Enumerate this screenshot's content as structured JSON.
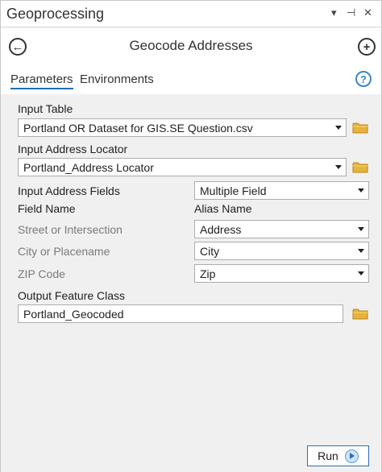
{
  "pane": {
    "title": "Geoprocessing",
    "menu_icon": "dropdown-arrow-icon",
    "pin_icon": "pin-icon",
    "close_icon": "close-icon"
  },
  "tool": {
    "title": "Geocode Addresses",
    "back_icon": "back-arrow-icon",
    "add_icon": "add-icon"
  },
  "tabs": {
    "parameters": "Parameters",
    "environments": "Environments",
    "help_icon": "help-icon",
    "help_glyph": "?"
  },
  "params": {
    "input_table_label": "Input Table",
    "input_table_value": "Portland OR Dataset for GIS.SE Question.csv",
    "locator_label": "Input Address Locator",
    "locator_value": "Portland_Address Locator",
    "fields_label": "Input Address Fields",
    "fields_value": "Multiple Field",
    "field_name_header": "Field Name",
    "alias_name_header": "Alias Name",
    "street_label": "Street or Intersection",
    "street_value": "Address",
    "city_label": "City or Placename",
    "city_value": "City",
    "zip_label": "ZIP Code",
    "zip_value": "Zip",
    "output_label": "Output Feature Class",
    "output_value": "Portland_Geocoded"
  },
  "run": {
    "label": "Run",
    "icon": "play-icon"
  },
  "colors": {
    "accent": "#1f6fb5",
    "folder": "#e8b33a"
  }
}
